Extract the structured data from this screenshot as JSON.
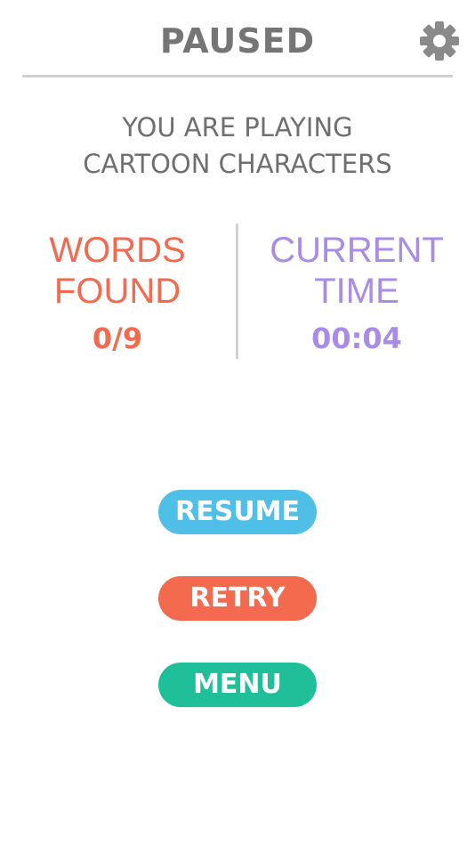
{
  "header": {
    "title": "PAUSED",
    "settings_icon": "gear-icon"
  },
  "subtitle": {
    "line1": "YOU ARE PLAYING",
    "line2": "CARTOON CHARACTERS"
  },
  "stats": {
    "words": {
      "label_line1": "WORDS",
      "label_line2": "FOUND",
      "value": "0/9",
      "color": "#f46a4f"
    },
    "time": {
      "label_line1": "CURRENT",
      "label_line2": "TIME",
      "value": "00:04",
      "color": "#a98be8"
    }
  },
  "buttons": {
    "resume": {
      "label": "RESUME",
      "color": "#4fbfe8"
    },
    "retry": {
      "label": "RETRY",
      "color": "#f46a4f"
    },
    "menu": {
      "label": "MENU",
      "color": "#1fbf9a"
    }
  }
}
